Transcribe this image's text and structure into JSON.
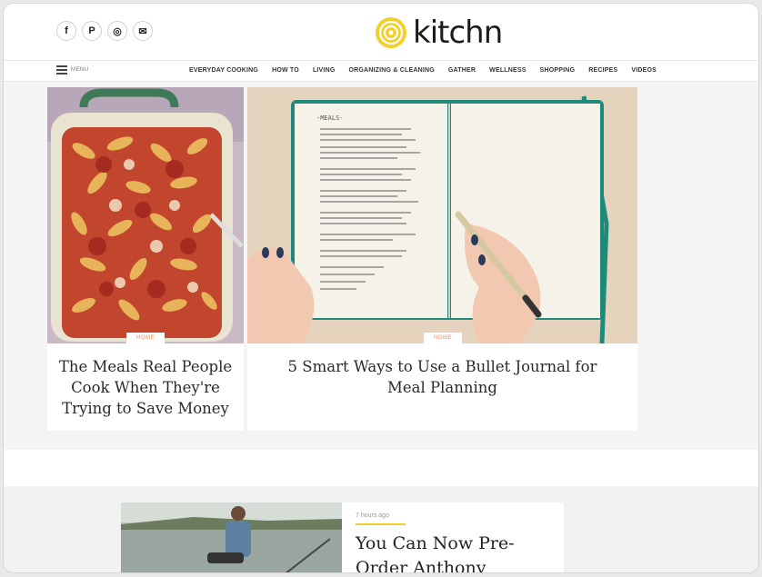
{
  "header": {
    "brand": "kitchn",
    "social": [
      {
        "icon": "facebook-icon",
        "glyph": "f"
      },
      {
        "icon": "pinterest-icon",
        "glyph": "P"
      },
      {
        "icon": "instagram-icon",
        "glyph": "◎"
      },
      {
        "icon": "email-icon",
        "glyph": "✉"
      }
    ]
  },
  "nav": {
    "menu_label": "MENU",
    "items": [
      "EVERYDAY COOKING",
      "HOW TO",
      "LIVING",
      "ORGANIZING & CLEANING",
      "GATHER",
      "WELLNESS",
      "SHOPPING",
      "RECIPES",
      "VIDEOS"
    ]
  },
  "cards": [
    {
      "badge": "HOME",
      "title": "The Meals Real People Cook When They're Trying to Save Money"
    },
    {
      "badge": "HOME",
      "title": "5 Smart Ways to Use a Bullet Journal for Meal Planning"
    }
  ],
  "journal": {
    "header": "-MEALS-"
  },
  "feature": {
    "timestamp": "7 hours ago",
    "title": "You Can Now Pre-Order Anthony"
  },
  "colors": {
    "logo_yellow": "#f3cf2b",
    "badge_text": "#e8906b",
    "accent": "#f3cf2b"
  }
}
